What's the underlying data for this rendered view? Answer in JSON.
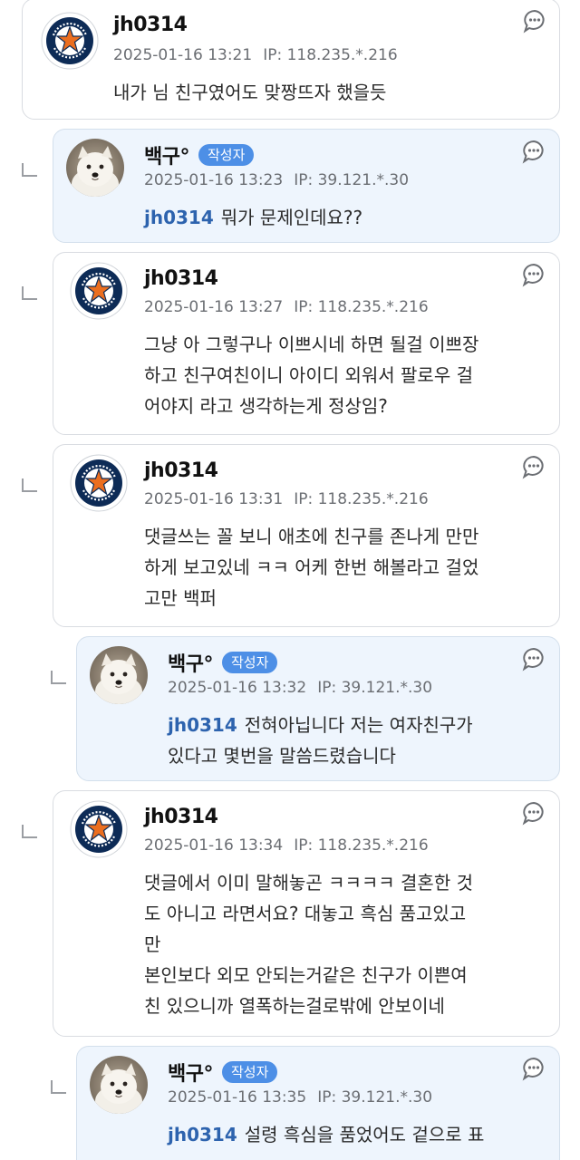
{
  "comments": [
    {
      "nickname": "jh0314",
      "badge": "",
      "date": "2025-01-16 13:21",
      "ip": "IP: 118.235.*.216",
      "mention": "",
      "lines": [
        "내가 님 친구였어도 맞짱뜨자 했을듯"
      ]
    },
    {
      "nickname": "백구°",
      "badge": "작성자",
      "date": "2025-01-16 13:23",
      "ip": "IP: 39.121.*.30",
      "mention": "jh0314",
      "lines": [
        "뭐가 문제인데요??"
      ]
    },
    {
      "nickname": "jh0314",
      "badge": "",
      "date": "2025-01-16 13:27",
      "ip": "IP: 118.235.*.216",
      "mention": "",
      "lines": [
        "그냥 아 그렇구나 이쁘시네 하면 될걸 이쁘장",
        "하고 친구여친이니 아이디 외워서 팔로우 걸",
        "어야지 라고 생각하는게 정상임?"
      ]
    },
    {
      "nickname": "jh0314",
      "badge": "",
      "date": "2025-01-16 13:31",
      "ip": "IP: 118.235.*.216",
      "mention": "",
      "lines": [
        "댓글쓰는 꼴 보니 애초에 친구를 존나게 만만",
        "하게 보고있네 ㅋㅋ 어케 한번 해볼라고 걸었",
        "고만 백퍼"
      ]
    },
    {
      "nickname": "백구°",
      "badge": "작성자",
      "date": "2025-01-16 13:32",
      "ip": "IP: 39.121.*.30",
      "mention": "jh0314",
      "lines": [
        "전혀아닙니다 저는 여자친구가",
        "있다고 몇번을 말씀드렸습니다"
      ]
    },
    {
      "nickname": "jh0314",
      "badge": "",
      "date": "2025-01-16 13:34",
      "ip": "IP: 118.235.*.216",
      "mention": "",
      "lines": [
        "댓글에서 이미 말해놓곤 ㅋㅋㅋㅋ 결혼한 것",
        "도 아니고 라면서요? 대놓고 흑심 품고있고",
        "만",
        "본인보다 외모 안되는거같은 친구가 이쁜여",
        "친 있으니까 열폭하는걸로밖에 안보이네"
      ]
    },
    {
      "nickname": "백구°",
      "badge": "작성자",
      "date": "2025-01-16 13:35",
      "ip": "IP: 39.121.*.30",
      "mention": "jh0314",
      "lines": [
        "설령 흑심을 품었어도 겉으로 표"
      ]
    }
  ],
  "icons": {
    "reply": "reply-bubble-icon",
    "reply_indent": "reply-indent-icon",
    "avatar_astros": "astros-logo-avatar",
    "avatar_dog": "dog-photo-avatar"
  },
  "colors": {
    "author_badge": "#4d8fe6",
    "mention": "#2d63ae",
    "author_card_bg": "#eef5fd",
    "card_border": "#d9dce1"
  }
}
